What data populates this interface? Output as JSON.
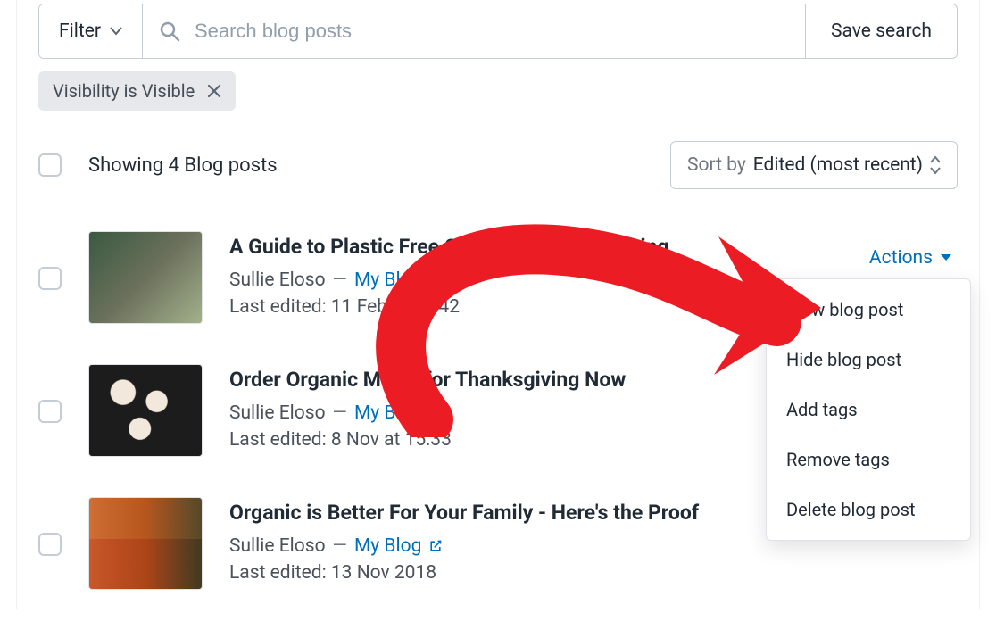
{
  "toolbar": {
    "filter_label": "Filter",
    "search_placeholder": "Search blog posts",
    "save_search_label": "Save search"
  },
  "chips": [
    {
      "label": "Visibility is Visible"
    }
  ],
  "list_header": {
    "showing_text": "Showing 4 Blog posts",
    "sort_prefix": "Sort by",
    "sort_value": "Edited (most recent)"
  },
  "actions_label": "Actions",
  "posts": [
    {
      "title": "A Guide to Plastic Free Compostable Packaging",
      "author": "Sullie Eloso",
      "blog_name": "My Blog",
      "last_edited": "Last edited: 11 Feb at 22:42",
      "thumb_class": "thumb-compost",
      "show_actions": true
    },
    {
      "title": "Order Organic Meals for Thanksgiving Now",
      "author": "Sullie Eloso",
      "blog_name": "My Blog",
      "last_edited": "Last edited: 8 Nov at 15:33",
      "thumb_class": "thumb-meals",
      "show_actions": false
    },
    {
      "title": "Organic is Better For Your Family - Here's the Proof",
      "author": "Sullie Eloso",
      "blog_name": "My Blog",
      "last_edited": "Last edited: 13 Nov 2018",
      "thumb_class": "thumb-organic",
      "show_actions": false
    }
  ],
  "actions_menu": [
    "View blog post",
    "Hide blog post",
    "Add tags",
    "Remove tags",
    "Delete blog post"
  ]
}
